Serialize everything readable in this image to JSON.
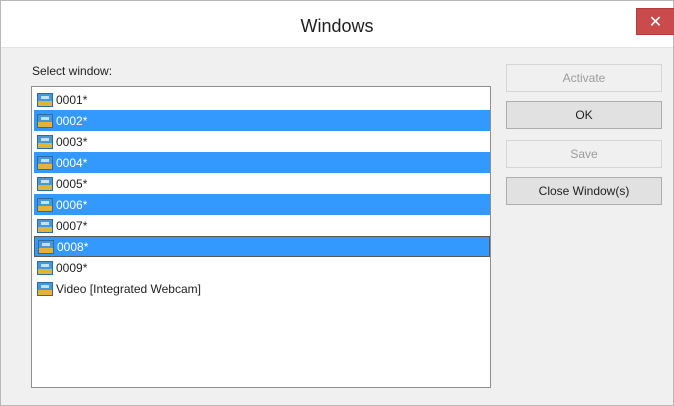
{
  "window": {
    "title": "Windows",
    "close_glyph": "✕"
  },
  "label": "Select window:",
  "items": [
    {
      "label": "0001*",
      "selected": false
    },
    {
      "label": "0002*",
      "selected": true
    },
    {
      "label": "0003*",
      "selected": false
    },
    {
      "label": "0004*",
      "selected": true
    },
    {
      "label": "0005*",
      "selected": false
    },
    {
      "label": "0006*",
      "selected": true
    },
    {
      "label": "0007*",
      "selected": false
    },
    {
      "label": "0008*",
      "selected": true,
      "focused": true
    },
    {
      "label": "0009*",
      "selected": false
    },
    {
      "label": "Video [Integrated Webcam]",
      "selected": false
    }
  ],
  "buttons": {
    "activate": "Activate",
    "ok": "OK",
    "save": "Save",
    "close_windows": "Close Window(s)"
  },
  "colors": {
    "selection": "#3399ff",
    "close": "#c94b4b"
  },
  "icons": {
    "item_icon": "image-icon",
    "close": "close-icon"
  }
}
